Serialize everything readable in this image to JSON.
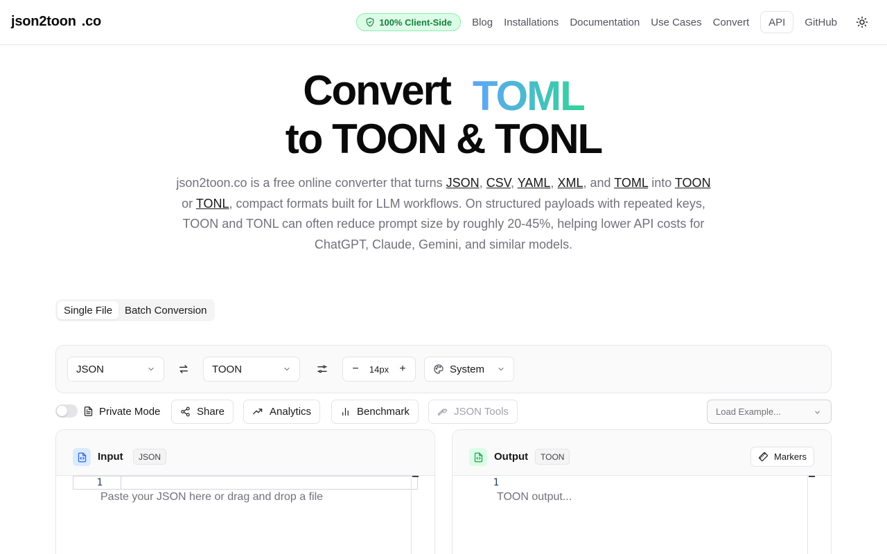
{
  "header": {
    "logo_name": "json2toon",
    "logo_tld": ".co",
    "badge": "100% Client-Side",
    "nav": [
      "Blog",
      "Installations",
      "Documentation",
      "Use Cases",
      "Convert"
    ],
    "api": "API",
    "github": "GitHub"
  },
  "hero": {
    "line1": "Convert",
    "accent": "TOML",
    "line2": "to TOON & TONL",
    "intro": {
      "t1": "json2toon.co is a free online converter that turns ",
      "json": "JSON",
      "c1": ", ",
      "csv": "CSV",
      "c2": ", ",
      "yaml": "YAML",
      "c3": ", ",
      "xml": "XML",
      "c4": ", and ",
      "toml": "TOML",
      "t2": " into ",
      "toon": "TOON",
      "t3": " or ",
      "tonl": "TONL",
      "t4": ", compact formats built for LLM workflows. On structured payloads with repeated keys, TOON and TONL can often reduce prompt size by roughly 20-45%, helping lower API costs for ChatGPT, Claude, Gemini, and similar models."
    }
  },
  "modes": {
    "single": "Single File",
    "batch": "Batch Conversion"
  },
  "toolbar": {
    "from": "JSON",
    "to": "TOON",
    "font_size": "14px",
    "theme": "System"
  },
  "actions": {
    "private": "Private Mode",
    "share": "Share",
    "analytics": "Analytics",
    "benchmark": "Benchmark",
    "json_tools": "JSON Tools",
    "load_example": "Load Example..."
  },
  "input_panel": {
    "title": "Input",
    "tag": "JSON",
    "line": "1",
    "placeholder": "Paste your JSON here or drag and drop a file"
  },
  "output_panel": {
    "title": "Output",
    "tag": "TOON",
    "markers": "Markers",
    "line": "1",
    "placeholder": "TOON output..."
  }
}
